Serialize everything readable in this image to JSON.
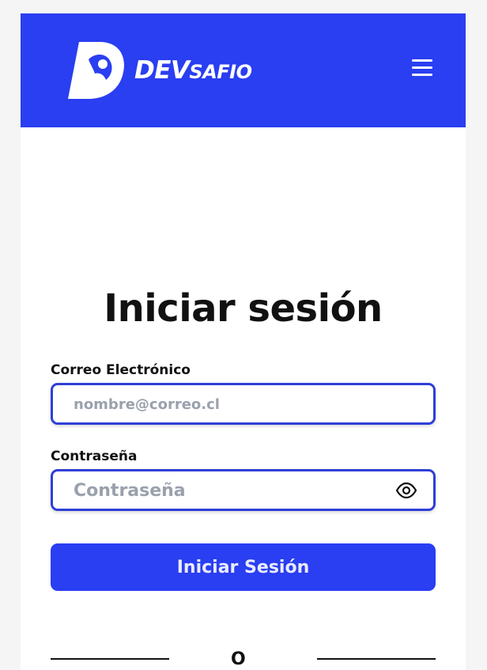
{
  "header": {
    "brand_big": "DEV",
    "brand_small": "SAFIO",
    "menu_icon": "hamburger-menu-icon",
    "background_color": "#2a3ef2"
  },
  "login": {
    "title": "Iniciar sesión",
    "email_label": "Correo Electrónico",
    "email_placeholder": "nombre@correo.cl",
    "email_value": "",
    "password_label": "Contraseña",
    "password_placeholder": "Contraseña",
    "password_value": "",
    "toggle_visibility_icon": "eye-icon",
    "submit_label": "Iniciar Sesión",
    "divider_text": "O"
  },
  "colors": {
    "accent": "#2a3ef2",
    "field_border": "#2f3fd8",
    "text": "#111111",
    "placeholder": "#9aa1ad"
  }
}
